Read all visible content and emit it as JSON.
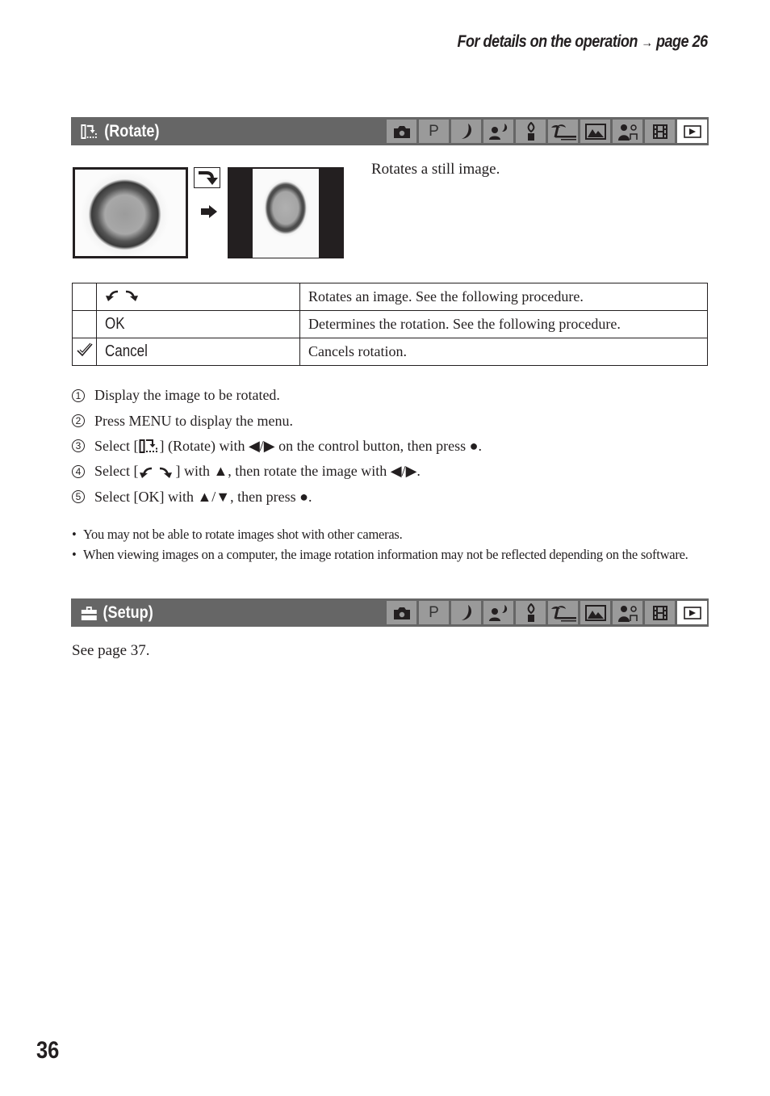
{
  "header": {
    "reference_text": "For details on the operation",
    "reference_arrow": "→",
    "reference_page": "page 26"
  },
  "rotate_section": {
    "title": "(Rotate)",
    "icon": "rotate-menu-icon",
    "mode_icons": [
      {
        "name": "auto-camera-icon",
        "active": false
      },
      {
        "name": "program-p-icon",
        "label": "P",
        "active": false
      },
      {
        "name": "twilight-moon-icon",
        "active": false
      },
      {
        "name": "twilight-portrait-icon",
        "active": false
      },
      {
        "name": "candle-icon",
        "active": false
      },
      {
        "name": "beach-palm-icon",
        "active": false
      },
      {
        "name": "landscape-icon",
        "active": false
      },
      {
        "name": "soft-snap-portrait-icon",
        "active": false
      },
      {
        "name": "movie-film-icon",
        "active": false
      },
      {
        "name": "playback-icon",
        "active": true
      }
    ],
    "intro_text": "Rotates a still image.",
    "illustration": {
      "before_label": "rotated-photo-before",
      "rotate_icon": "rotate-clockwise-icon",
      "arrow_icon": "arrow-right-icon",
      "after_label": "upright-photo-after"
    },
    "options_table": [
      {
        "check": "",
        "icon": "rotate-left-right-icon",
        "option": "",
        "description": "Rotates an image. See the following procedure."
      },
      {
        "check": "",
        "icon": "",
        "option": "OK",
        "description": "Determines the rotation. See the following procedure."
      },
      {
        "check": "checkmark-icon",
        "icon": "",
        "option": "Cancel",
        "description": "Cancels rotation."
      }
    ],
    "steps": [
      {
        "num": "1",
        "text": "Display the image to be rotated."
      },
      {
        "num": "2",
        "text": "Press MENU to display the menu."
      },
      {
        "num": "3",
        "pre": "Select [",
        "post": "] (Rotate) with ◀/▶ on the control button, then press ●."
      },
      {
        "num": "4",
        "pre": "Select [",
        "post": "] with ▲, then rotate the image with ◀/▶."
      },
      {
        "num": "5",
        "text": "Select [OK] with ▲/▼, then press ●."
      }
    ],
    "notes": [
      "You may not be able to rotate images shot with other cameras.",
      "When viewing images on a computer, the image rotation information may not be reflected depending on the software."
    ]
  },
  "setup_section": {
    "title": "(Setup)",
    "icon": "toolbox-setup-icon",
    "body_text": "See page 37."
  },
  "page_number": "36"
}
